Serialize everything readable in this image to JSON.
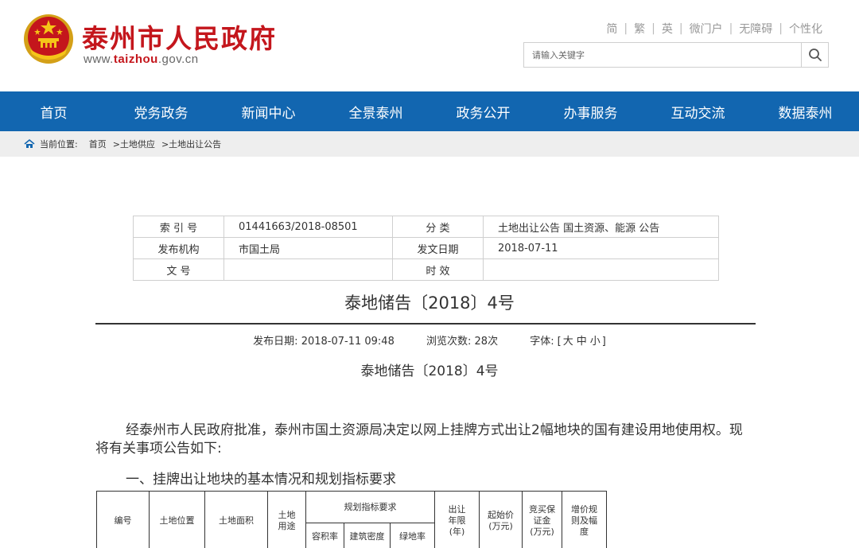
{
  "header": {
    "site_title": "泰州市人民政府",
    "url_prefix": "www.",
    "url_brand": "taizhou",
    "url_suffix": ".gov.cn",
    "brand_color": "#c4161c"
  },
  "toplinks": [
    "简",
    "繁",
    "英",
    "微门户",
    "无障碍",
    "个性化"
  ],
  "search": {
    "placeholder": "请输入关键字",
    "icon": "search-icon"
  },
  "nav": {
    "bg_color": "#1266b0",
    "items": [
      "首页",
      "党务政务",
      "新闻中心",
      "全景泰州",
      "政务公开",
      "办事服务",
      "互动交流",
      "数据泰州"
    ]
  },
  "breadcrumb": {
    "label": "当前位置:",
    "items": [
      "首页",
      ">土地供应",
      ">土地出让公告"
    ]
  },
  "meta": {
    "index_label": "索 引 号",
    "index_value": "01441663/2018-08501",
    "category_label": "分    类",
    "category_value": "土地出让公告 国土资源、能源 公告",
    "publisher_label": "发布机构",
    "publisher_value": "市国土局",
    "date_label": "发文日期",
    "date_value": "2018-07-11",
    "docno_label": "文    号",
    "docno_value": "",
    "validity_label": "时    效",
    "validity_value": ""
  },
  "doc": {
    "title": "泰地储告〔2018〕4号",
    "pub_date_label": "发布日期:",
    "pub_date": "2018-07-11 09:48",
    "views_label": "浏览次数:",
    "views": "28次",
    "font_label": "字体:",
    "font_open": "[",
    "font_large": "大",
    "font_medium": "中",
    "font_small": "小",
    "font_close": "]",
    "subtitle": "泰地储告〔2018〕4号",
    "paragraph": "经泰州市人民政府批准，泰州市国土资源局决定以网上挂牌方式出让2幅地块的国有建设用地使用权。现将有关事项公告如下:",
    "section_heading": "一、挂牌出让地块的基本情况和规划指标要求"
  },
  "lot_table": {
    "col_number": "编号",
    "col_location": "土地位置",
    "col_area": "土地面积",
    "col_use": "土地用途",
    "col_planning": "规划指标要求",
    "col_far": "容积率",
    "col_density": "建筑密度",
    "col_green": "绿地率",
    "col_years": "出让年限(年)",
    "col_start_price": "起始价(万元)",
    "col_deposit": "竞买保证金(万元)",
    "col_increment": "增价规则及幅度"
  }
}
